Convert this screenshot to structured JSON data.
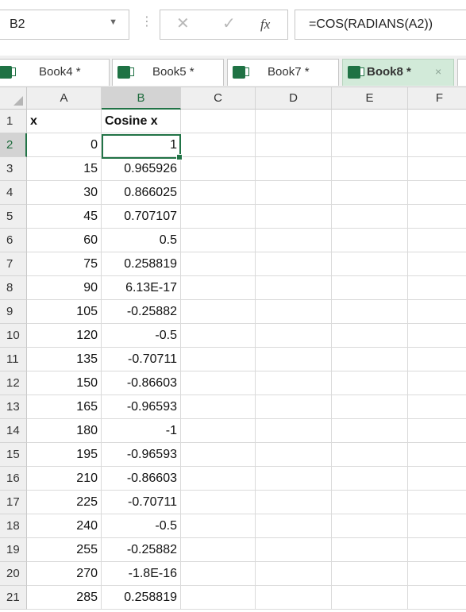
{
  "formula_bar": {
    "name_box": "B2",
    "formula": "=COS(RADIANS(A2))"
  },
  "icons": {
    "name_box_dropdown": "▼",
    "more_dots": "⋮",
    "cancel": "✕",
    "enter": "✓",
    "function": "fx"
  },
  "workbook_tabs": [
    {
      "label": "Book4 *",
      "active": false
    },
    {
      "label": "Book5 *",
      "active": false
    },
    {
      "label": "Book7 *",
      "active": false
    },
    {
      "label": "Book8 *",
      "active": true
    }
  ],
  "close_glyph": "×",
  "active_cell": "B2",
  "columns": [
    "A",
    "B",
    "C",
    "D",
    "E",
    "F"
  ],
  "rows": [
    {
      "n": "1",
      "a": "x",
      "b": "Cosine x"
    },
    {
      "n": "2",
      "a": "0",
      "b": "1"
    },
    {
      "n": "3",
      "a": "15",
      "b": "0.965926"
    },
    {
      "n": "4",
      "a": "30",
      "b": "0.866025"
    },
    {
      "n": "5",
      "a": "45",
      "b": "0.707107"
    },
    {
      "n": "6",
      "a": "60",
      "b": "0.5"
    },
    {
      "n": "7",
      "a": "75",
      "b": "0.258819"
    },
    {
      "n": "8",
      "a": "90",
      "b": "6.13E-17"
    },
    {
      "n": "9",
      "a": "105",
      "b": "-0.25882"
    },
    {
      "n": "10",
      "a": "120",
      "b": "-0.5"
    },
    {
      "n": "11",
      "a": "135",
      "b": "-0.70711"
    },
    {
      "n": "12",
      "a": "150",
      "b": "-0.86603"
    },
    {
      "n": "13",
      "a": "165",
      "b": "-0.96593"
    },
    {
      "n": "14",
      "a": "180",
      "b": "-1"
    },
    {
      "n": "15",
      "a": "195",
      "b": "-0.96593"
    },
    {
      "n": "16",
      "a": "210",
      "b": "-0.86603"
    },
    {
      "n": "17",
      "a": "225",
      "b": "-0.70711"
    },
    {
      "n": "18",
      "a": "240",
      "b": "-0.5"
    },
    {
      "n": "19",
      "a": "255",
      "b": "-0.25882"
    },
    {
      "n": "20",
      "a": "270",
      "b": "-1.8E-16"
    },
    {
      "n": "21",
      "a": "285",
      "b": "0.258819"
    }
  ],
  "colors": {
    "accent": "#217346",
    "active_tab_bg": "#d2ead9",
    "header_bg": "#efefef",
    "selected_header_bg": "#d3d3d3"
  }
}
